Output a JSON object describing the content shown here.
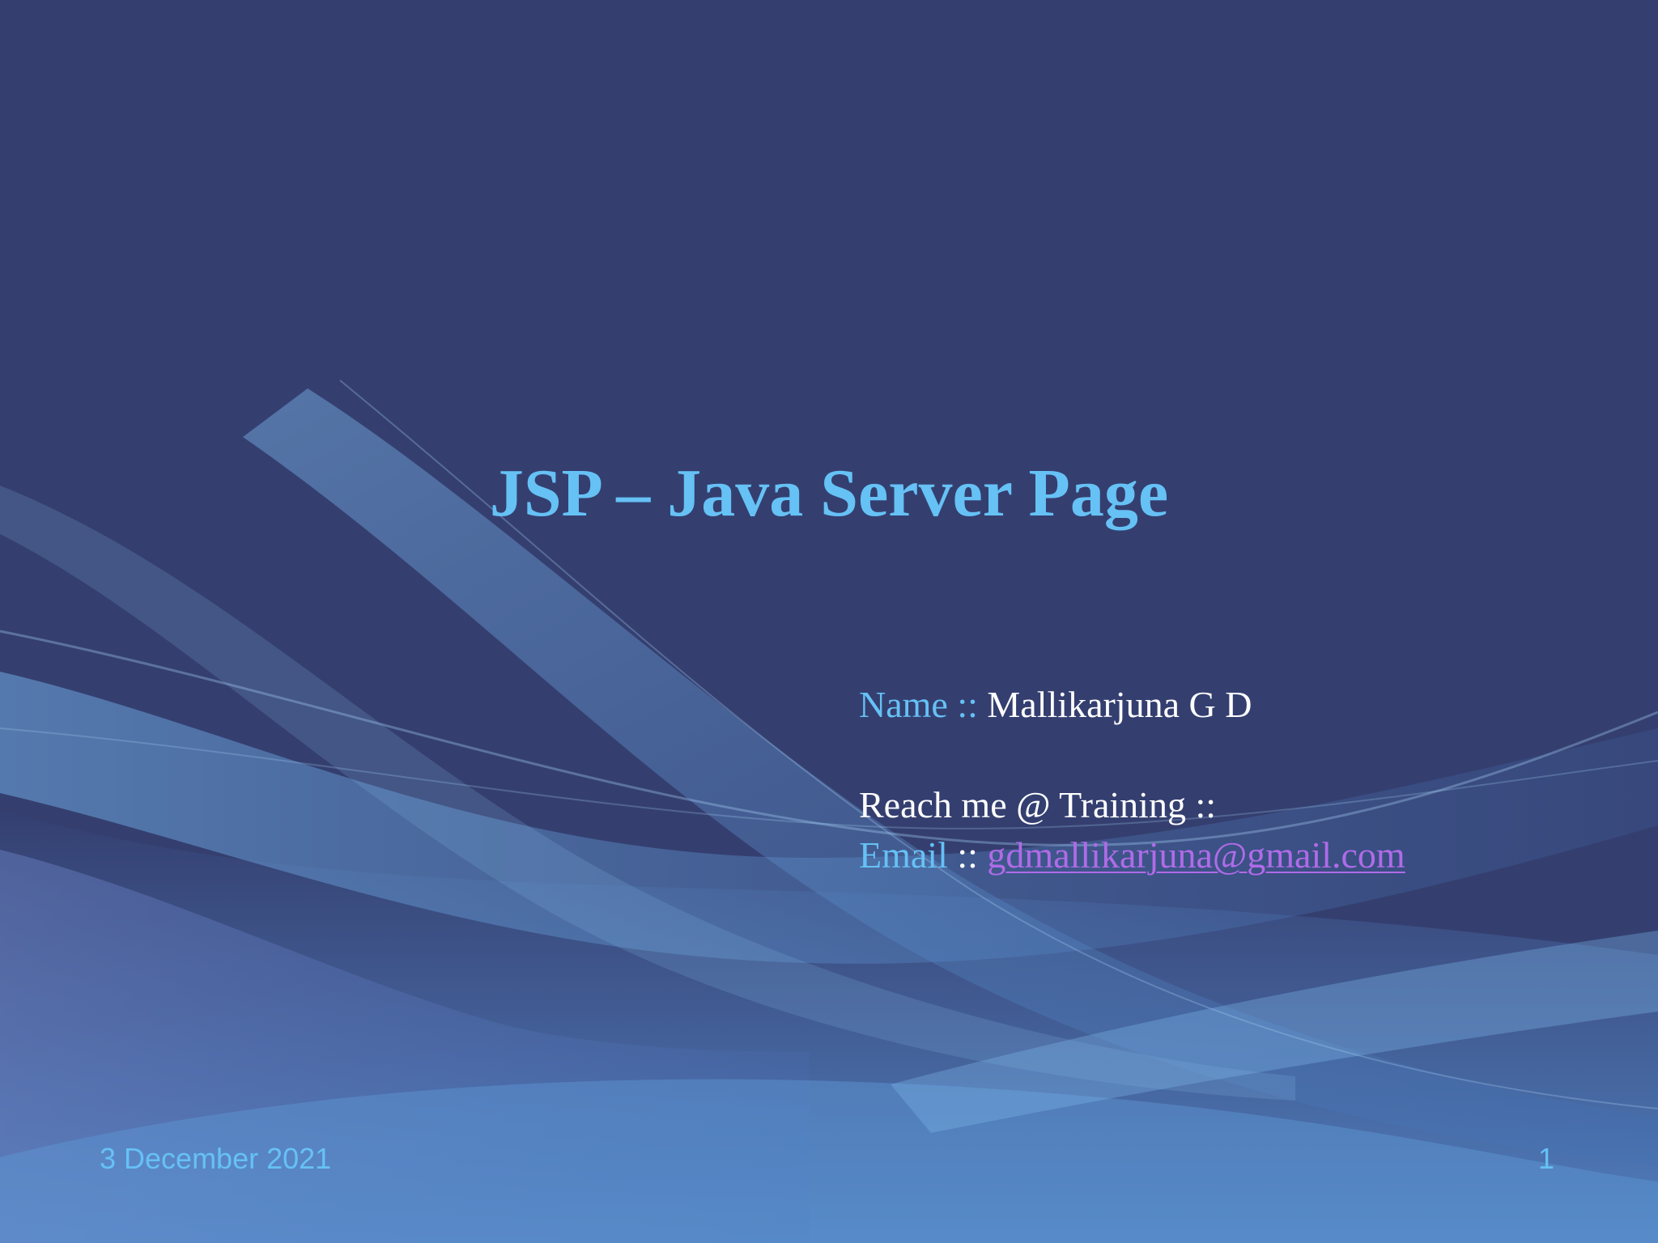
{
  "slide": {
    "title": "JSP – Java Server Page",
    "name_label": "Name ::",
    "name_value": "Mallikarjuna G D",
    "reach_line": "Reach me @ Training ::",
    "email_label": "Email",
    "email_separator": "::",
    "email_value": "gdmallikarjuna@gmail.com",
    "date": "3 December 2021",
    "page_number": "1"
  },
  "colors": {
    "background": "#343f70",
    "accent": "#66c1f5",
    "link": "#b06be8",
    "text": "#ffffff"
  }
}
